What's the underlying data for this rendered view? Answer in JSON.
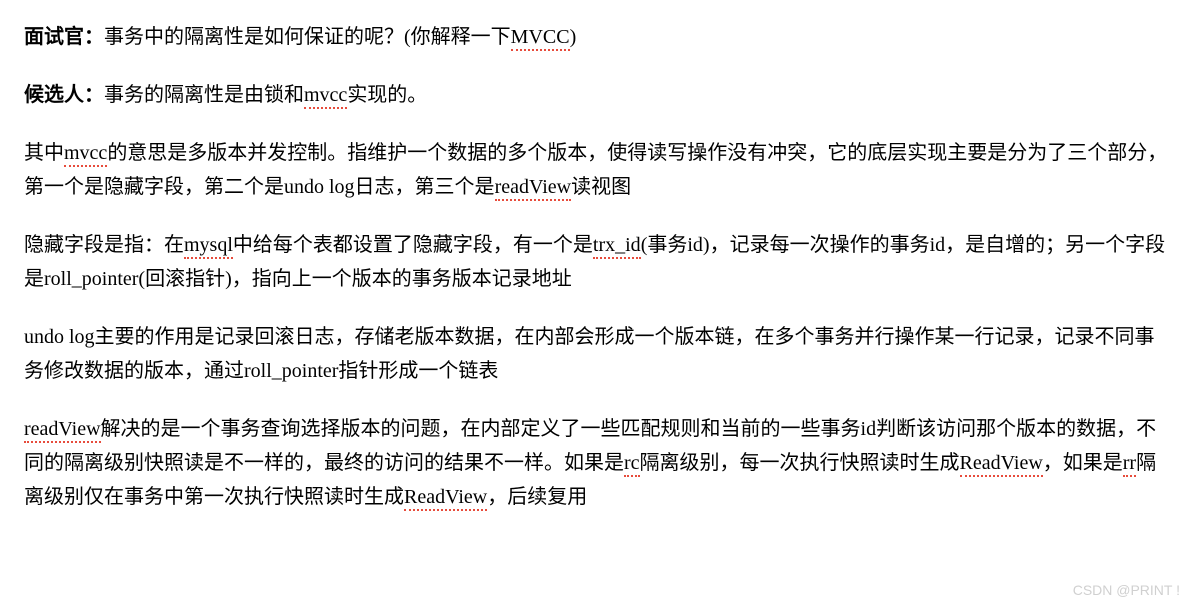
{
  "p1": {
    "speaker": "面试官：",
    "t1": "事务中的隔离性是如何保证的呢？(你解释一下",
    "u1": "MVCC",
    "t2": ")"
  },
  "p2": {
    "speaker": "候选人：",
    "t1": "事务的隔离性是由锁和",
    "u1": "mvcc",
    "t2": "实现的。"
  },
  "p3": {
    "t1": "其中",
    "u1": "mvcc",
    "t2": "的意思是多版本并发控制。指维护一个数据的多个版本，使得读写操作没有冲突，它的底层实现主要是分为了三个部分，第一个是隐藏字段，第二个是undo log日志，第三个是",
    "u2": "readView",
    "t3": "读视图"
  },
  "p4": {
    "t1": "隐藏字段是指：在",
    "u1": "mysql",
    "t2": "中给每个表都设置了隐藏字段，有一个是",
    "u2": "trx_id",
    "t3": "(事务id)，记录每一次操作的事务id，是自增的；另一个字段是roll_pointer(回滚指针)，指向上一个版本的事务版本记录地址"
  },
  "p5": {
    "t1": "undo log主要的作用是记录回滚日志，存储老版本数据，在内部会形成一个版本链，在多个事务并行操作某一行记录，记录不同事务修改数据的版本，通过roll_pointer指针形成一个链表"
  },
  "p6": {
    "u1": "readView",
    "t1": "解决的是一个事务查询选择版本的问题，在内部定义了一些匹配规则和当前的一些事务id判断该访问那个版本的数据，不同的隔离级别快照读是不一样的，最终的访问的结果不一样。如果是",
    "u2": "rc",
    "t2": "隔离级别，每一次执行快照读时生成",
    "u3": "ReadView",
    "t3": "，如果是",
    "u4": "rr",
    "t4": "隔离级别仅在事务中第一次执行快照读时生成",
    "u5": "ReadView",
    "t5": "，后续复用"
  },
  "watermark": "CSDN @PRINT !"
}
